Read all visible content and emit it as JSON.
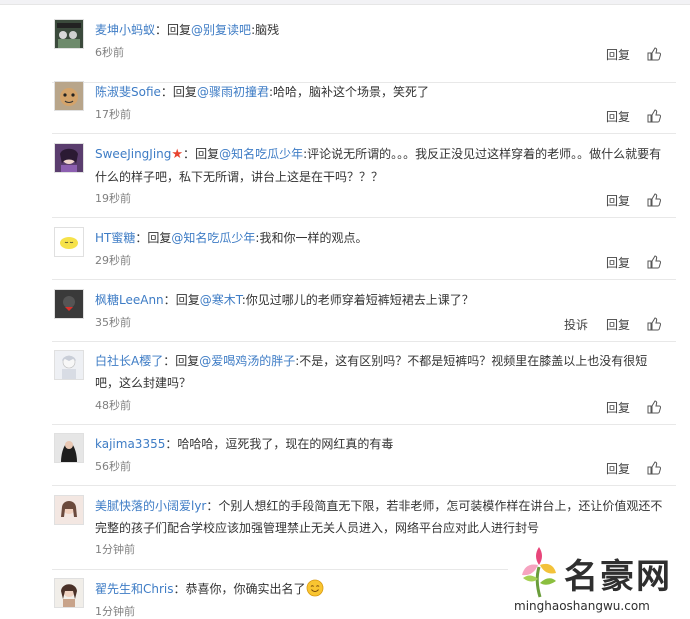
{
  "comments": [
    {
      "user": "麦坤小蚂蚁",
      "sep": "：",
      "reply_prefix": "回复",
      "mention": "@别复读吧",
      "text": ":脑残",
      "time": "6秒前"
    },
    {
      "user": "陈淑斐Sofie",
      "sep": "：",
      "reply_prefix": "回复",
      "mention": "@骤雨初撞君",
      "text": ":哈哈，脑补这个场景，笑死了",
      "time": "17秒前"
    },
    {
      "user": "SweeJingJing",
      "badge": "★",
      "sep": "：",
      "reply_prefix": "回复",
      "mention": "@知名吃瓜少年",
      "text": ":评论说无所谓的。。。我反正没见过这样穿着的老师。。做什么就要有什么的样子吧，私下无所谓，讲台上这是在干吗？？？",
      "time": "19秒前"
    },
    {
      "user": "HT蜜糖",
      "sep": "：",
      "reply_prefix": "回复",
      "mention": "@知名吃瓜少年",
      "text": ":我和你一样的观点。",
      "time": "29秒前"
    },
    {
      "user": "枫糖LeeAnn",
      "sep": "：",
      "reply_prefix": "回复",
      "mention": "@寒木T",
      "text": ":你见过哪儿的老师穿着短裤短裙去上课了？",
      "time": "35秒前",
      "report": "投诉"
    },
    {
      "user": "白社长A樱了",
      "sep": "：",
      "reply_prefix": "回复",
      "mention": "@爱喝鸡汤的胖子",
      "text": ":不是，这有区别吗？不都是短裤吗？视频里在膝盖以上也没有很短吧，这么封建吗？",
      "time": "48秒前"
    },
    {
      "user": "kajima3355",
      "sep": "：",
      "reply_prefix": "",
      "mention": "",
      "text": "哈哈哈，逗死我了，现在的网红真的有毒",
      "time": "56秒前"
    },
    {
      "user": "美腻快落的小阔爱lyr",
      "sep": "：",
      "reply_prefix": "",
      "mention": "",
      "text": "个别人想红的手段简直无下限，若非老师，怎可装模作样在讲台上，还让价值观还不完整的孩子们配合学校应该加强管理禁止无关人员进入，网络平台应对此人进行封号",
      "time": "1分钟前"
    },
    {
      "user": "翟先生和Chris",
      "sep": "：",
      "reply_prefix": "",
      "mention": "",
      "text": "恭喜你，你确实出名了",
      "time": "1分钟前",
      "emoji": "smile-emoji"
    }
  ],
  "labels": {
    "reply": "回复",
    "report": "投诉"
  },
  "watermark": {
    "brand": "名豪网",
    "url": "minghaoshangwu.com"
  },
  "colors": {
    "link": "#3e7cc5",
    "text": "#333333",
    "time": "#808080"
  }
}
